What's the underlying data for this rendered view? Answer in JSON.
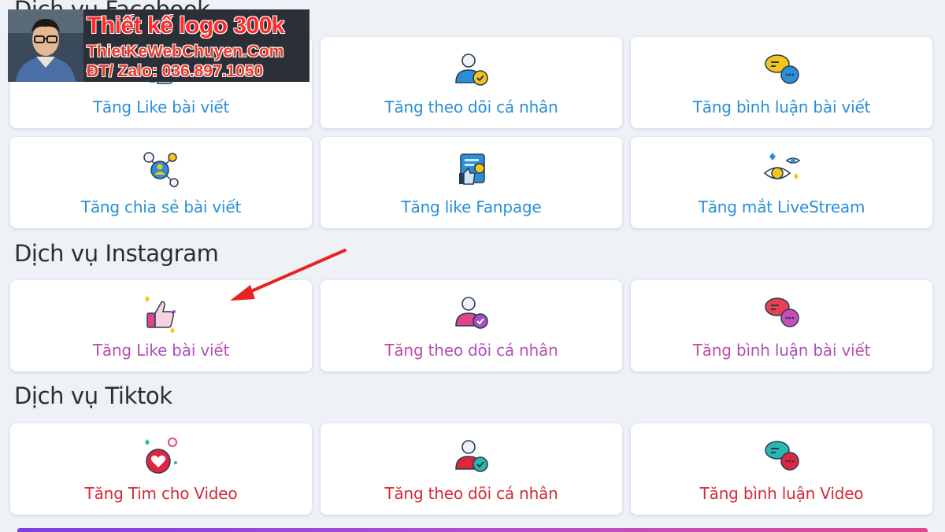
{
  "sections": {
    "facebook": {
      "title": "Dịch vụ Facebook",
      "items": [
        {
          "label": "Tăng Like bài viết",
          "icon": "thumbs-up-icon"
        },
        {
          "label": "Tăng theo dõi cá nhân",
          "icon": "user-follow-icon"
        },
        {
          "label": "Tăng bình luận bài viết",
          "icon": "comment-bubbles-icon"
        },
        {
          "label": "Tăng chia sẻ bài viết",
          "icon": "share-network-icon"
        },
        {
          "label": "Tăng like Fanpage",
          "icon": "fanpage-like-icon"
        },
        {
          "label": "Tăng mắt LiveStream",
          "icon": "eye-livestream-icon"
        }
      ]
    },
    "instagram": {
      "title": "Dịch vụ Instagram",
      "items": [
        {
          "label": "Tăng Like bài viết",
          "icon": "thumbs-up-icon"
        },
        {
          "label": "Tăng theo dõi cá nhân",
          "icon": "user-follow-icon"
        },
        {
          "label": "Tăng bình luận bài viết",
          "icon": "comment-bubbles-icon"
        }
      ]
    },
    "tiktok": {
      "title": "Dịch vụ Tiktok",
      "items": [
        {
          "label": "Tăng Tim cho Video",
          "icon": "heart-icon"
        },
        {
          "label": "Tăng theo dõi cá nhân",
          "icon": "user-follow-icon"
        },
        {
          "label": "Tăng bình luận Video",
          "icon": "comment-bubbles-icon"
        }
      ]
    }
  },
  "promo": {
    "headline": "Thiết kế logo 300k",
    "website": "ThietKeWebChuyen.Com",
    "contact": "ĐT/ Zalo: 036.897.1050"
  },
  "colors": {
    "facebook_label": "#2a8fd6",
    "tiktok_label": "#d42a35",
    "instagram_gradient": [
      "#e0458a",
      "#a44fc4"
    ],
    "arrow": "#e8231f"
  }
}
